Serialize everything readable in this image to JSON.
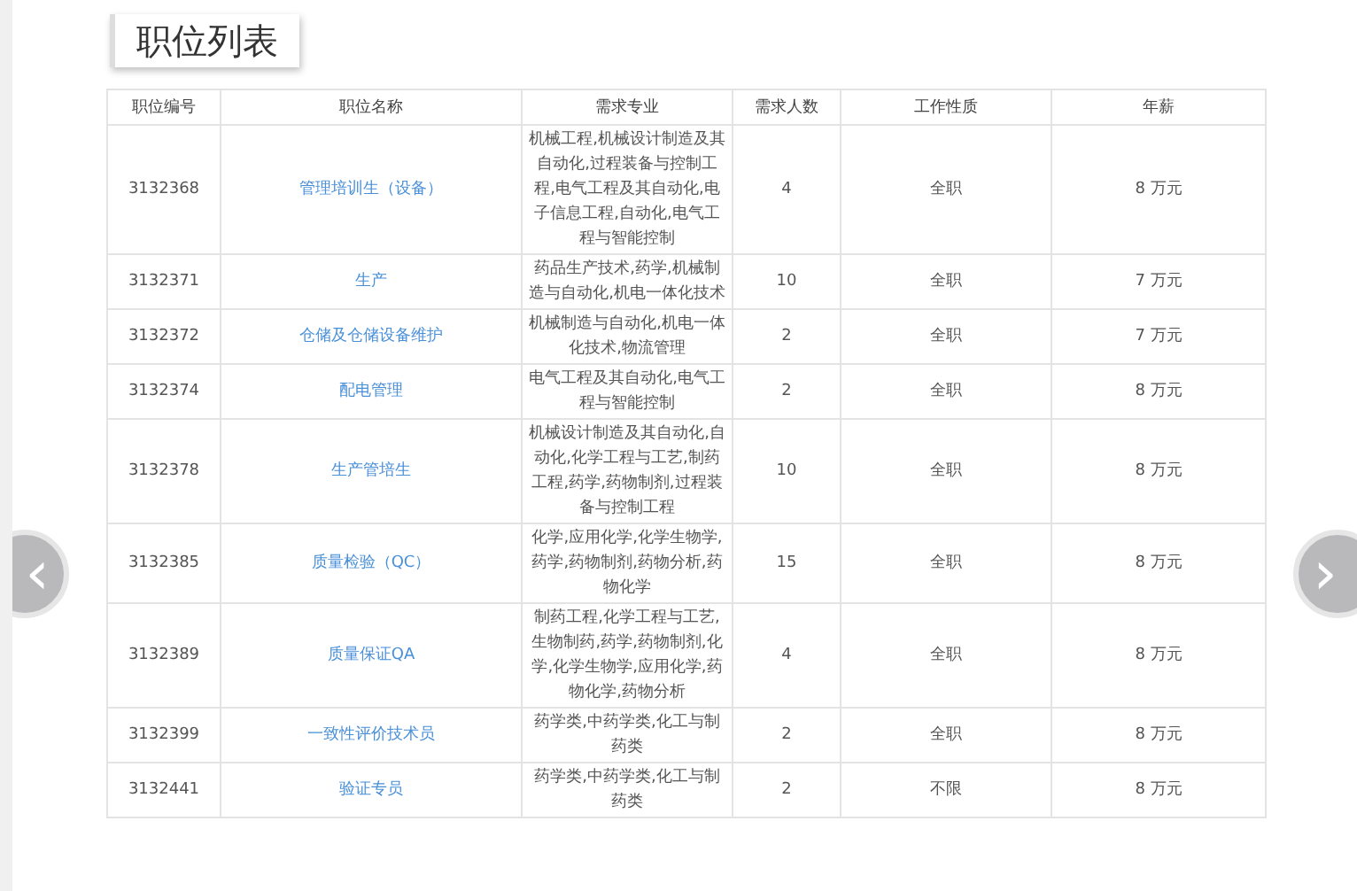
{
  "title": "职位列表",
  "table": {
    "columns": [
      "职位编号",
      "职位名称",
      "需求专业",
      "需求人数",
      "工作性质",
      "年薪"
    ],
    "rows": [
      {
        "id": "3132368",
        "name": "管理培训生（设备）",
        "major": "机械工程,机械设计制造及其自动化,过程装备与控制工程,电气工程及其自动化,电子信息工程,自动化,电气工程与智能控制",
        "count": "4",
        "type": "全职",
        "salary": "8 万元"
      },
      {
        "id": "3132371",
        "name": "生产",
        "major": "药品生产技术,药学,机械制造与自动化,机电一体化技术",
        "count": "10",
        "type": "全职",
        "salary": "7 万元"
      },
      {
        "id": "3132372",
        "name": "仓储及仓储设备维护",
        "major": "机械制造与自动化,机电一体化技术,物流管理",
        "count": "2",
        "type": "全职",
        "salary": "7 万元"
      },
      {
        "id": "3132374",
        "name": "配电管理",
        "major": "电气工程及其自动化,电气工程与智能控制",
        "count": "2",
        "type": "全职",
        "salary": "8 万元"
      },
      {
        "id": "3132378",
        "name": "生产管培生",
        "major": "机械设计制造及其自动化,自动化,化学工程与工艺,制药工程,药学,药物制剂,过程装备与控制工程",
        "count": "10",
        "type": "全职",
        "salary": "8 万元"
      },
      {
        "id": "3132385",
        "name": "质量检验（QC）",
        "major": "化学,应用化学,化学生物学,药学,药物制剂,药物分析,药物化学",
        "count": "15",
        "type": "全职",
        "salary": "8 万元"
      },
      {
        "id": "3132389",
        "name": "质量保证QA",
        "major": "制药工程,化学工程与工艺,生物制药,药学,药物制剂,化学,化学生物学,应用化学,药物化学,药物分析",
        "count": "4",
        "type": "全职",
        "salary": "8 万元"
      },
      {
        "id": "3132399",
        "name": "一致性评价技术员",
        "major": "药学类,中药学类,化工与制药类",
        "count": "2",
        "type": "全职",
        "salary": "8 万元"
      },
      {
        "id": "3132441",
        "name": "验证专员",
        "major": "药学类,中药学类,化工与制药类",
        "count": "2",
        "type": "不限",
        "salary": "8 万元"
      }
    ]
  },
  "carousel": {
    "prev": "‹",
    "next": "›"
  }
}
